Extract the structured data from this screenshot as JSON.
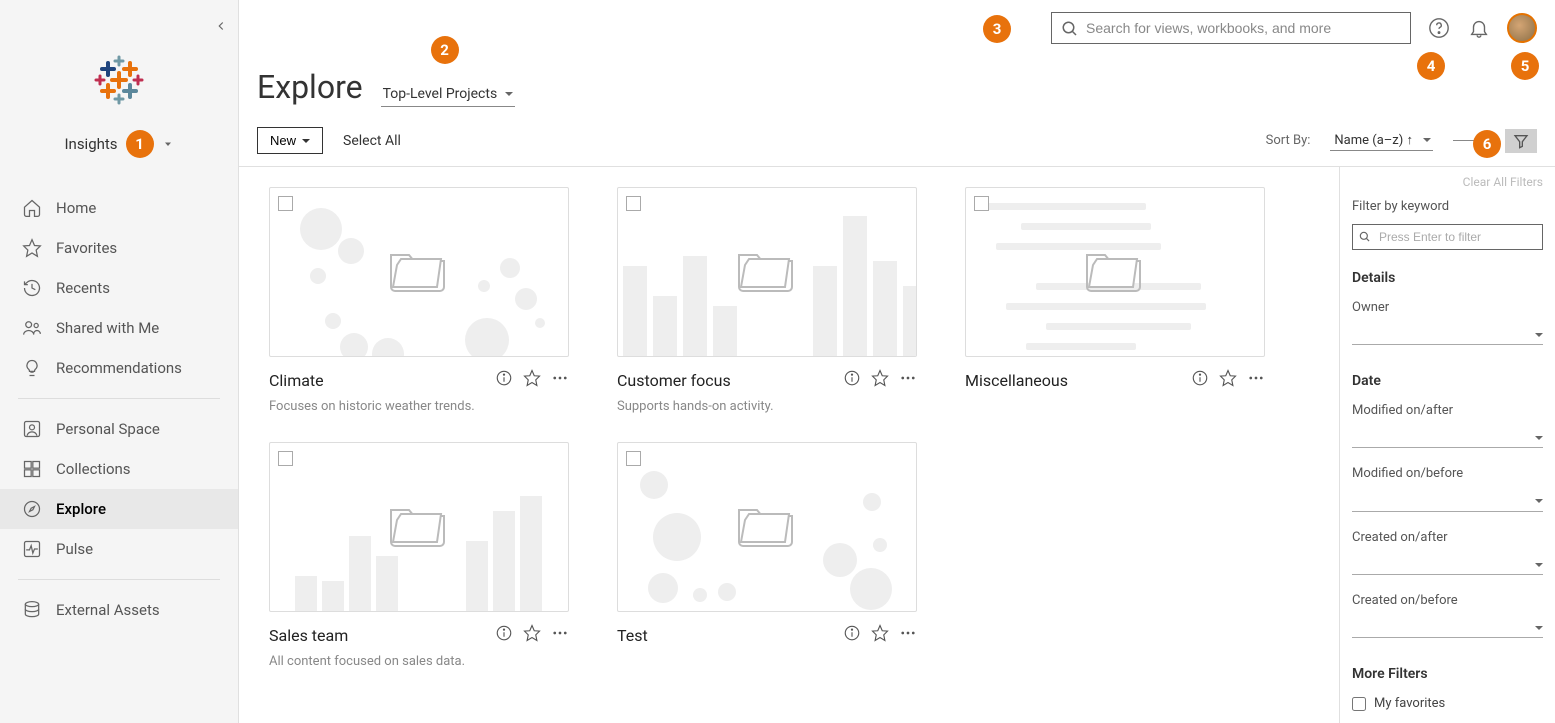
{
  "site_name": "Insights",
  "header_title": "Explore",
  "scope_dropdown": "Top-Level Projects",
  "search_placeholder": "Search for views, workbooks, and more",
  "new_button": "New",
  "select_all": "Select All",
  "sort_by_label": "Sort By:",
  "sort_by_value": "Name (a–z) ↑",
  "nav": {
    "home": "Home",
    "favorites": "Favorites",
    "recents": "Recents",
    "shared": "Shared with Me",
    "recommendations": "Recommendations",
    "personal_space": "Personal Space",
    "collections": "Collections",
    "explore": "Explore",
    "pulse": "Pulse",
    "external_assets": "External Assets"
  },
  "cards": [
    {
      "title": "Climate",
      "desc": "Focuses on historic weather trends."
    },
    {
      "title": "Customer focus",
      "desc": "Supports hands-on activity."
    },
    {
      "title": "Miscellaneous",
      "desc": ""
    },
    {
      "title": "Sales team",
      "desc": "All content focused on sales data."
    },
    {
      "title": "Test",
      "desc": ""
    }
  ],
  "filter_panel": {
    "clear": "Clear All Filters",
    "keyword_label": "Filter by keyword",
    "keyword_placeholder": "Press Enter to filter",
    "details_title": "Details",
    "owner_label": "Owner",
    "date_title": "Date",
    "mod_after": "Modified on/after",
    "mod_before": "Modified on/before",
    "created_after": "Created on/after",
    "created_before": "Created on/before",
    "more_title": "More Filters",
    "my_favorites": "My favorites"
  },
  "annotations": [
    "1",
    "2",
    "3",
    "4",
    "5",
    "6"
  ]
}
